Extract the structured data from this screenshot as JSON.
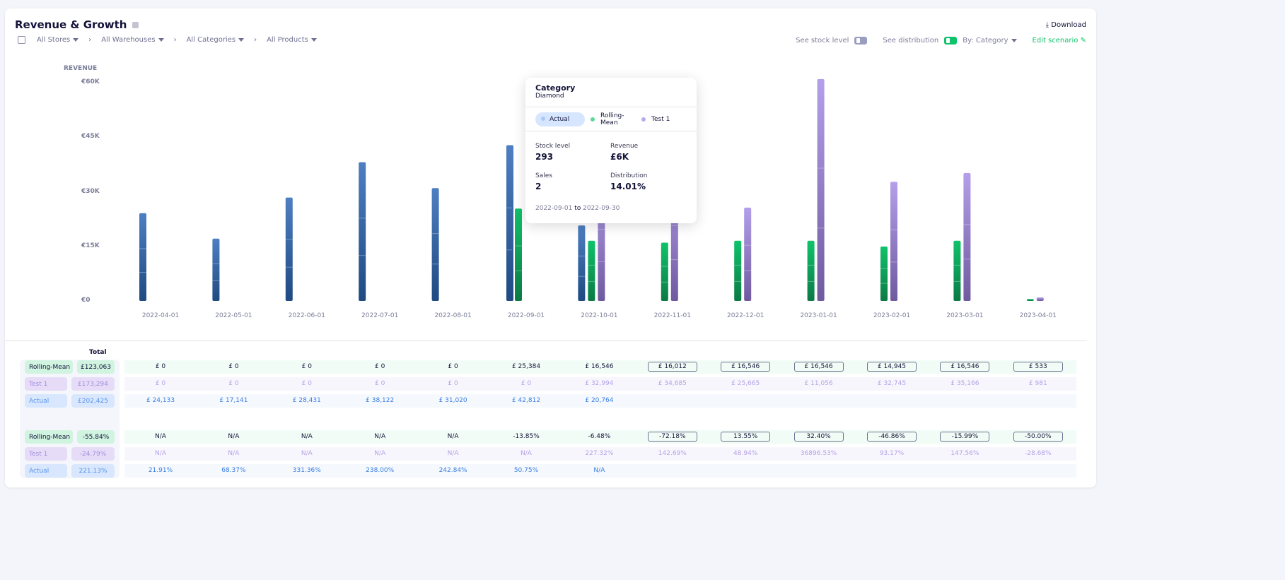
{
  "header": {
    "title": "Revenue & Growth",
    "download": "Download",
    "filters": [
      "All Stores",
      "All Warehouses",
      "All Categories",
      "All Products"
    ],
    "see_stock": "See stock level",
    "see_distribution": "See distribution",
    "by": "By: Category",
    "edit": "Edit scenario",
    "stock_toggle_on": false,
    "distribution_toggle_on": true
  },
  "colors": {
    "actual": "#2f5d9c",
    "rolling": "#11a860",
    "test": "#8e7ac4",
    "accent": "#11c26d"
  },
  "chart_data": {
    "type": "bar",
    "ylabel": "REVENUE",
    "ylim": [
      0,
      60000
    ],
    "yticks": [
      "€0",
      "€15K",
      "€30K",
      "€45K",
      "€60K"
    ],
    "ytick_values": [
      0,
      15000,
      30000,
      45000,
      60000
    ],
    "categories": [
      "2022-04-01",
      "2022-05-01",
      "2022-06-01",
      "2022-07-01",
      "2022-08-01",
      "2022-09-01",
      "2022-10-01",
      "2022-11-01",
      "2022-12-01",
      "2023-01-01",
      "2023-02-01",
      "2023-03-01",
      "2023-04-01"
    ],
    "series": [
      {
        "name": "Actual",
        "values": [
          24133,
          17141,
          28431,
          38122,
          31020,
          42812,
          20764,
          null,
          null,
          null,
          null,
          null,
          null
        ]
      },
      {
        "name": "Rolling-Mean",
        "values": [
          0,
          0,
          0,
          0,
          0,
          25384,
          16546,
          16012,
          16546,
          16546,
          14945,
          16546,
          533
        ]
      },
      {
        "name": "Test 1",
        "values": [
          0,
          0,
          0,
          0,
          0,
          0,
          32994,
          34685,
          25665,
          61000,
          32745,
          35166,
          981
        ]
      }
    ]
  },
  "tooltip": {
    "title": "Category",
    "subtitle": "Diamond",
    "legend": [
      "Actual",
      "Rolling-Mean",
      "Test 1"
    ],
    "stock_label": "Stock level",
    "stock": "293",
    "revenue_label": "Revenue",
    "revenue": "£6K",
    "sales_label": "Sales",
    "sales": "2",
    "dist_label": "Distribution",
    "dist": "14.01%",
    "from": "2022-09-01",
    "to_word": "to",
    "to": "2022-09-30"
  },
  "table": {
    "total_header": "Total",
    "revenue": [
      {
        "name": "Rolling-Mean",
        "total": "£123,063",
        "cells": [
          "£ 0",
          "£ 0",
          "£ 0",
          "£ 0",
          "£ 0",
          "£ 25,384",
          "£ 16,546",
          "£ 16,012",
          "£ 16,546",
          "£ 16,546",
          "£ 14,945",
          "£ 16,546",
          "£ 533"
        ]
      },
      {
        "name": "Test 1",
        "total": "£173,294",
        "cells": [
          "£ 0",
          "£ 0",
          "£ 0",
          "£ 0",
          "£ 0",
          "£ 0",
          "£ 32,994",
          "£ 34,685",
          "£ 25,665",
          "£ 11,056",
          "£ 32,745",
          "£ 35,166",
          "£ 981"
        ]
      },
      {
        "name": "Actual",
        "total": "£202,425",
        "cells": [
          "£ 24,133",
          "£ 17,141",
          "£ 28,431",
          "£ 38,122",
          "£ 31,020",
          "£ 42,812",
          "£ 20,764",
          "",
          "",
          "",
          "",
          "",
          ""
        ]
      }
    ],
    "growth": [
      {
        "name": "Rolling-Mean",
        "total": "-55.84%",
        "cells": [
          "N/A",
          "N/A",
          "N/A",
          "N/A",
          "N/A",
          "-13.85%",
          "-6.48%",
          "-72.18%",
          "13.55%",
          "32.40%",
          "-46.86%",
          "-15.99%",
          "-50.00%"
        ]
      },
      {
        "name": "Test 1",
        "total": "-24.79%",
        "cells": [
          "N/A",
          "N/A",
          "N/A",
          "N/A",
          "N/A",
          "N/A",
          "227.32%",
          "142.69%",
          "48.94%",
          "36896.53%",
          "93.17%",
          "147.56%",
          "-28.68%"
        ]
      },
      {
        "name": "Actual",
        "total": "221.13%",
        "cells": [
          "21.91%",
          "68.37%",
          "331.36%",
          "238.00%",
          "242.84%",
          "50.75%",
          "N/A",
          "",
          "",
          "",
          "",
          "",
          ""
        ]
      }
    ]
  }
}
